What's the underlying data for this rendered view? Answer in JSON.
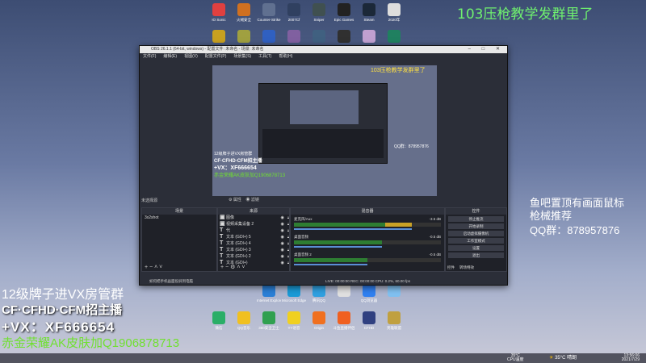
{
  "top_overlay": "103压枪教学发群里了",
  "right_overlay": {
    "line1": "鱼吧置顶有画面鼠标",
    "line2": "枪械推荐",
    "qq": "QQ群：878957876"
  },
  "left_overlay": {
    "line1": "12级牌子进VX房管群",
    "line2": "CF·CFHD·CFM招主播",
    "line3": "+VX：XF666654",
    "line4": "赤金荣耀AK皮肤加Q1906878713"
  },
  "desktop_icons_top": [
    {
      "label": "IO Sonic",
      "icon": "app-icon",
      "color": "#e04040"
    },
    {
      "label": "火绒安全",
      "icon": "app-icon",
      "color": "#d07020"
    },
    {
      "label": "Counter-Strike",
      "icon": "game-icon",
      "color": "#607090"
    },
    {
      "label": "2007Cf",
      "icon": "game-icon",
      "color": "#304060"
    },
    {
      "label": "Sniper",
      "icon": "game-icon",
      "color": "#405050"
    },
    {
      "label": "Epic Games",
      "icon": "store-icon",
      "color": "#222222"
    },
    {
      "label": "Steam",
      "icon": "steam-icon",
      "color": "#1b2838"
    },
    {
      "label": "2020年",
      "icon": "doc-icon",
      "color": "#dddddd"
    }
  ],
  "desktop_icons_row2": [
    {
      "label": "",
      "color": "#c8a020"
    },
    {
      "label": "",
      "color": "#a0a040"
    },
    {
      "label": "",
      "color": "#3060c0"
    },
    {
      "label": "",
      "color": "#8060a0"
    },
    {
      "label": "",
      "color": "#406080"
    },
    {
      "label": "",
      "color": "#303030"
    },
    {
      "label": "",
      "color": "#c0a0d0"
    },
    {
      "label": "",
      "color": "#208060"
    }
  ],
  "desktop_icons_bottom": [
    {
      "label": "微信",
      "color": "#2aae67"
    },
    {
      "label": "QQ音乐",
      "color": "#f0c020"
    },
    {
      "label": "360安全卫士",
      "color": "#30a050"
    },
    {
      "label": "YY语音",
      "color": "#f0d020"
    },
    {
      "label": "Origin",
      "color": "#f07020"
    },
    {
      "label": "斗鱼直播伴侣",
      "color": "#f06020"
    },
    {
      "label": "CFHD",
      "color": "#304080"
    },
    {
      "label": "英雄联盟",
      "color": "#c0a040"
    }
  ],
  "desktop_icons_mid": [
    {
      "label": "Internet Explorer",
      "color": "#2a7fd6"
    },
    {
      "label": "Microsoft Edge",
      "color": "#1a9ad6"
    },
    {
      "label": "腾讯QQ",
      "color": "#30a0e0"
    },
    {
      "label": "",
      "color": "#e0e0e0"
    },
    {
      "label": "QQ浏览器",
      "color": "#3080f0"
    },
    {
      "label": "",
      "color": "#80c0f0"
    }
  ],
  "obs": {
    "title": "OBS 26.1.1 (64-bit, windows) - 配置文件: 未命名 - 场景: 未命名",
    "menu": [
      "文件(F)",
      "编辑(E)",
      "视图(V)",
      "配置文件(P)",
      "场景集(S)",
      "工具(T)",
      "帮助(H)"
    ],
    "no_source": "未选择源",
    "props_label": "属性",
    "filters_label": "滤镜",
    "scenes_header": "场景",
    "scenes": [
      "3x2shot"
    ],
    "sources_header": "来源",
    "sources": [
      {
        "name": "图像",
        "icon": "image-icon"
      },
      {
        "name": "视频采集设备 2",
        "icon": "camera-icon"
      },
      {
        "name": "代",
        "icon": "text-icon"
      },
      {
        "name": "文本 (GDI+) 5",
        "icon": "text-icon"
      },
      {
        "name": "文本 (GDI+) 4",
        "icon": "text-icon"
      },
      {
        "name": "文本 (GDI+) 3",
        "icon": "text-icon"
      },
      {
        "name": "文本 (GDI+) 2",
        "icon": "text-icon"
      },
      {
        "name": "文本 (GDI+)",
        "icon": "text-icon"
      }
    ],
    "mixer_header": "混音器",
    "mixer": [
      {
        "name": "麦克风/Aux",
        "db": "-3.5 dB",
        "level": 0.8
      },
      {
        "name": "桌面音频",
        "db": "-0.5 dB",
        "level": 0.6
      },
      {
        "name": "桌面音频 2",
        "db": "-0.5 dB",
        "level": 0.5
      }
    ],
    "controls_header": "控件",
    "controls": [
      "停止推流",
      "开始录制",
      "启动虚拟摄像机",
      "工作室模式",
      "设置",
      "退出"
    ],
    "controls_tabs": [
      "控件",
      "转场特效"
    ],
    "status": "LIVE: 00:00:00   REC: 00:00:00   CPU: 0.2%, 60.00 fps",
    "notice": "如何把手机画面投屏到电脑"
  },
  "taskbar": {
    "cpu_temp": "35°C",
    "cpu_label": "CPU温度",
    "weather": "35°C 晴朗",
    "time": "13:56:06",
    "date": "2021/7/29"
  },
  "colors": {
    "overlay_green": "#6ff06f",
    "obs_bg": "#2b2e38",
    "accent_blue": "#5a8fd6"
  }
}
